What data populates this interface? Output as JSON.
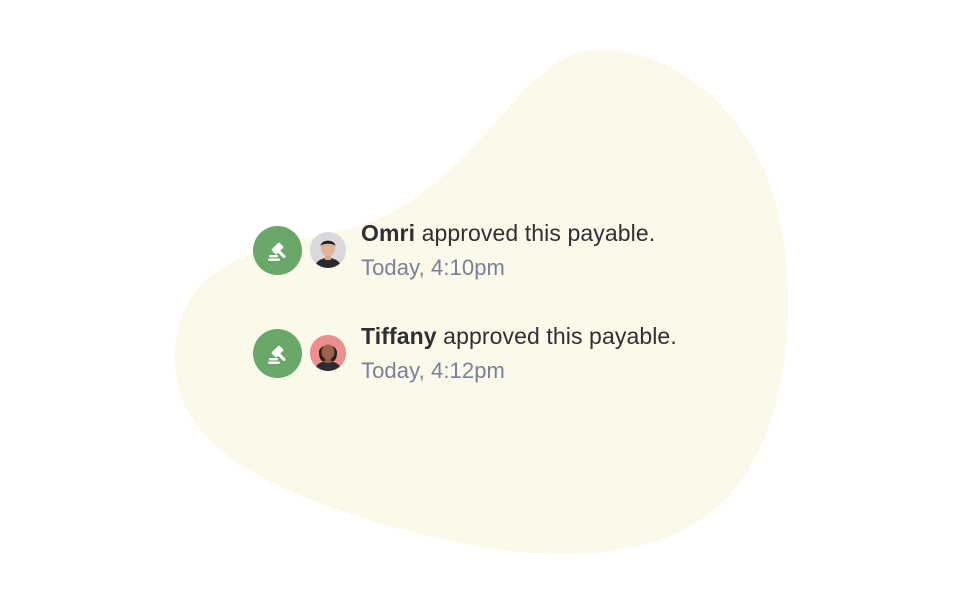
{
  "colors": {
    "background": "#ffffff",
    "blob": "#fbf9ea",
    "approve_badge": "#6aa86a",
    "text_primary": "#2f2f35",
    "text_muted": "#79809a"
  },
  "activity": [
    {
      "icon": "gavel-icon",
      "actor": "Omri",
      "action": " approved this payable.",
      "time": "Today, 4:10pm",
      "avatar_bg": "#d9d9dd"
    },
    {
      "icon": "gavel-icon",
      "actor": "Tiffany",
      "action": " approved this payable.",
      "time": "Today, 4:12pm",
      "avatar_bg": "#ee8f8f"
    }
  ]
}
